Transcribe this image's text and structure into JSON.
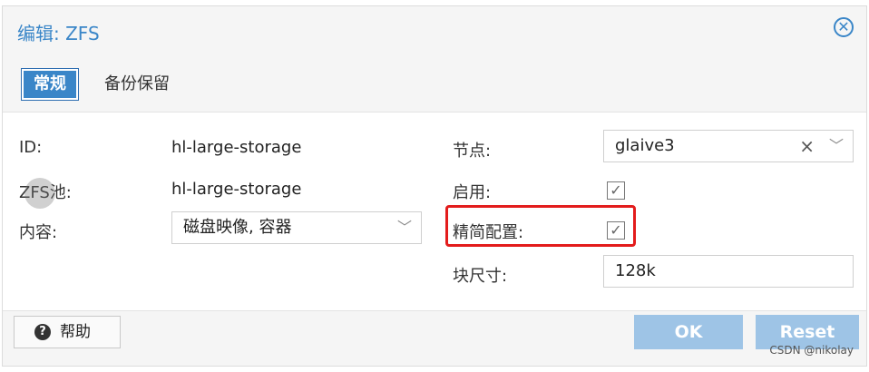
{
  "dialog": {
    "title": "编辑: ZFS",
    "close_glyph": "✕"
  },
  "tabs": [
    {
      "label": "常规",
      "active": true
    },
    {
      "label": "备份保留",
      "active": false
    }
  ],
  "form": {
    "id_label": "ID:",
    "id_value": "hl-large-storage",
    "pool_label": "ZFS池:",
    "pool_value": "hl-large-storage",
    "content_label": "内容:",
    "content_value": "磁盘映像, 容器",
    "node_label": "节点:",
    "node_value": "glaive3",
    "enable_label": "启用:",
    "enable_checked": true,
    "thin_label": "精简配置:",
    "thin_checked": true,
    "blocksize_label": "块尺寸:",
    "blocksize_value": "128k"
  },
  "footer": {
    "help_label": "帮助",
    "ok_label": "OK",
    "reset_label": "Reset"
  },
  "watermark": "CSDN @nikolay",
  "colors": {
    "accent": "#3a86c8",
    "highlight": "#e31c1c",
    "button_disabled": "#9ec4e6"
  }
}
